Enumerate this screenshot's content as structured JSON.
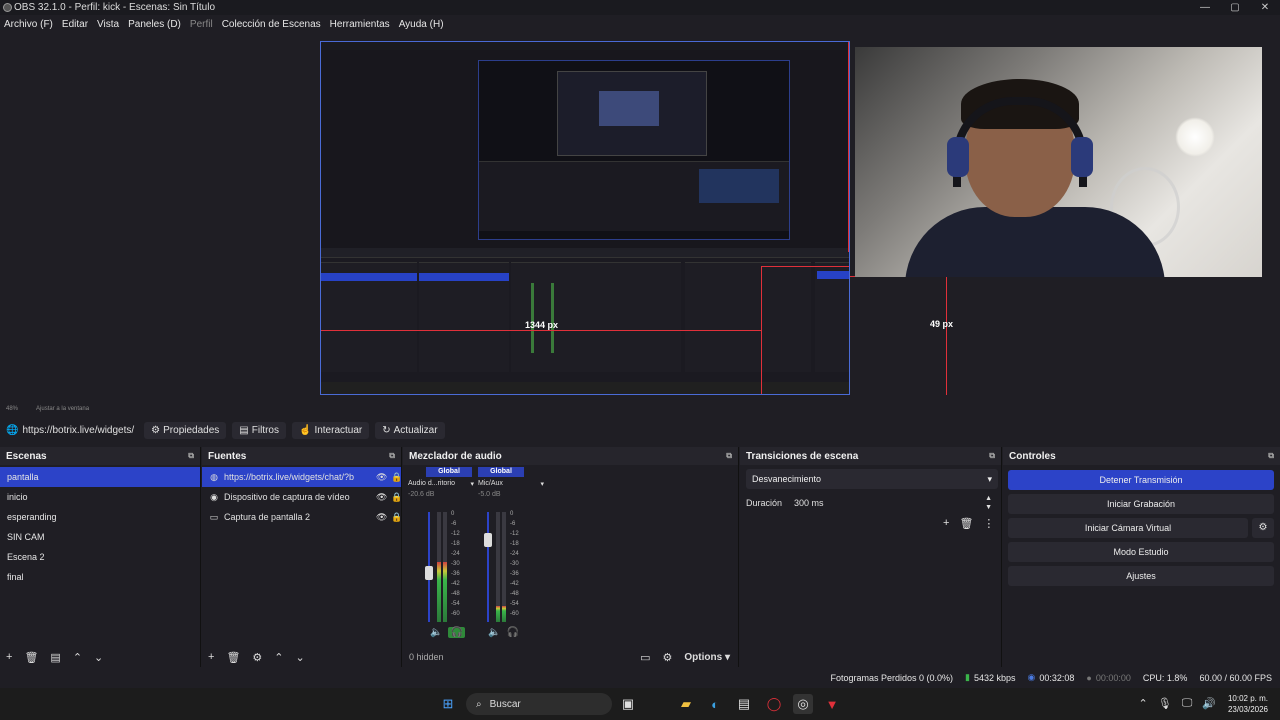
{
  "window": {
    "title": "OBS 32.1.0 - Perfil: kick - Escenas: Sin Título",
    "controls": [
      "—",
      "▢",
      "✕"
    ]
  },
  "menu": [
    "Archivo (F)",
    "Editar",
    "Vista",
    "Paneles (D)",
    "Perfil",
    "Colección de Escenas",
    "Herramientas",
    "Ayuda (H)"
  ],
  "preview": {
    "measure_width": "1344 px",
    "measure_right": "49 px",
    "zoom": "48%",
    "zoom_label": "Ajustar a la ventana"
  },
  "source_toolbar": {
    "url": "https://botrix.live/widgets/",
    "properties": "Propiedades",
    "filters": "Filtros",
    "interact": "Interactuar",
    "refresh": "Actualizar"
  },
  "scenes": {
    "title": "Escenas",
    "items": [
      "pantalla",
      "inicio",
      "esperanding",
      "SIN CAM",
      "Escena 2",
      "final"
    ],
    "selected": "pantalla"
  },
  "sources": {
    "title": "Fuentes",
    "items": [
      {
        "name": "https://botrix.live/widgets/chat/?b",
        "icon": "globe-icon"
      },
      {
        "name": "Dispositivo de captura de vídeo",
        "icon": "camera-icon"
      },
      {
        "name": "Captura de pantalla 2",
        "icon": "monitor-icon"
      }
    ]
  },
  "mixer": {
    "title": "Mezclador de audio",
    "channels": [
      {
        "global": "Global",
        "name": "Audio d...ritorio",
        "db": "-20.6 dB",
        "level": 0.55,
        "fader": 0.45
      },
      {
        "global": "Global",
        "name": "Mic/Aux",
        "db": "-5.0 dB",
        "level": 0.15,
        "fader": 0.75
      }
    ],
    "scale": [
      "0",
      "-6",
      "-12",
      "-18",
      "-24",
      "-30",
      "-36",
      "-42",
      "-48",
      "-54",
      "-60"
    ],
    "hidden": "0 hidden",
    "options": "Options"
  },
  "transitions": {
    "title": "Transiciones de escena",
    "selected": "Desvanecimiento",
    "duration_label": "Duración",
    "duration_value": "300 ms"
  },
  "controls": {
    "title": "Controles",
    "stop_stream": "Detener Transmisión",
    "start_recording": "Iniciar Grabación",
    "virtual_cam": "Iniciar Cámara Virtual",
    "studio_mode": "Modo Estudio",
    "settings": "Ajustes"
  },
  "status": {
    "dropped": "Fotogramas Perdidos 0 (0.0%)",
    "bitrate": "5432 kbps",
    "stream_time": "00:32:08",
    "rec_time": "00:00:00",
    "cpu": "CPU: 1.8%",
    "fps": "60.00 / 60.00 FPS"
  },
  "taskbar": {
    "search": "Buscar",
    "time": "10:02 p. m.",
    "date": "23/03/2026"
  },
  "colors": {
    "accent": "#2c43c8",
    "measure": "#e0303a",
    "bg": "#1f1e24"
  }
}
